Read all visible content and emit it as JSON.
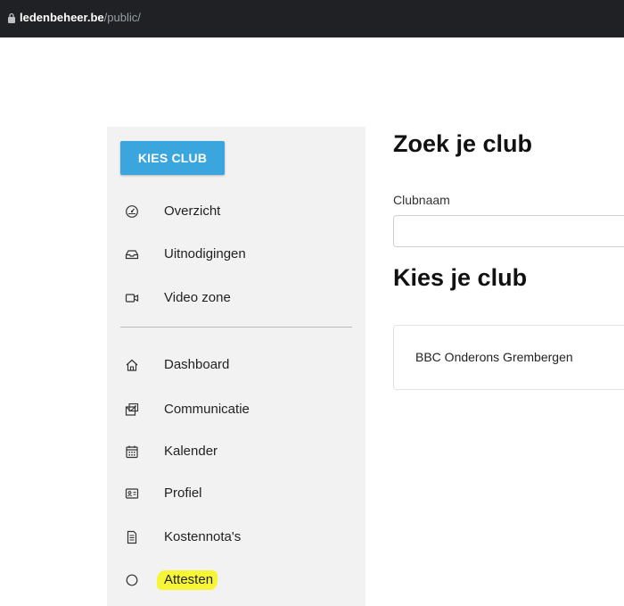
{
  "browser": {
    "host": "ledenbeheer.be",
    "path": "/public/"
  },
  "sidebar": {
    "kies_club_label": "KIES CLUB",
    "items": [
      {
        "label": "Overzicht",
        "icon": "dashboard-gauge-icon"
      },
      {
        "label": "Uitnodigingen",
        "icon": "inbox-icon"
      },
      {
        "label": "Video zone",
        "icon": "video-camera-icon"
      },
      {
        "label": "Dashboard",
        "icon": "home-icon"
      },
      {
        "label": "Communicatie",
        "icon": "mail-card-icon"
      },
      {
        "label": "Kalender",
        "icon": "calendar-icon"
      },
      {
        "label": "Profiel",
        "icon": "id-card-icon"
      },
      {
        "label": "Kostennota's",
        "icon": "document-icon"
      },
      {
        "label": "Attesten",
        "icon": "circle-icon"
      }
    ]
  },
  "main": {
    "search_heading": "Zoek je club",
    "clubname_label": "Clubnaam",
    "clubname_value": "",
    "choose_heading": "Kies je club",
    "clubs": [
      {
        "name": "BBC Onderons Grembergen"
      }
    ]
  },
  "colors": {
    "accent": "#3aa6dd",
    "highlight": "#f6f636",
    "sidebar_bg": "#f2f2f2"
  }
}
